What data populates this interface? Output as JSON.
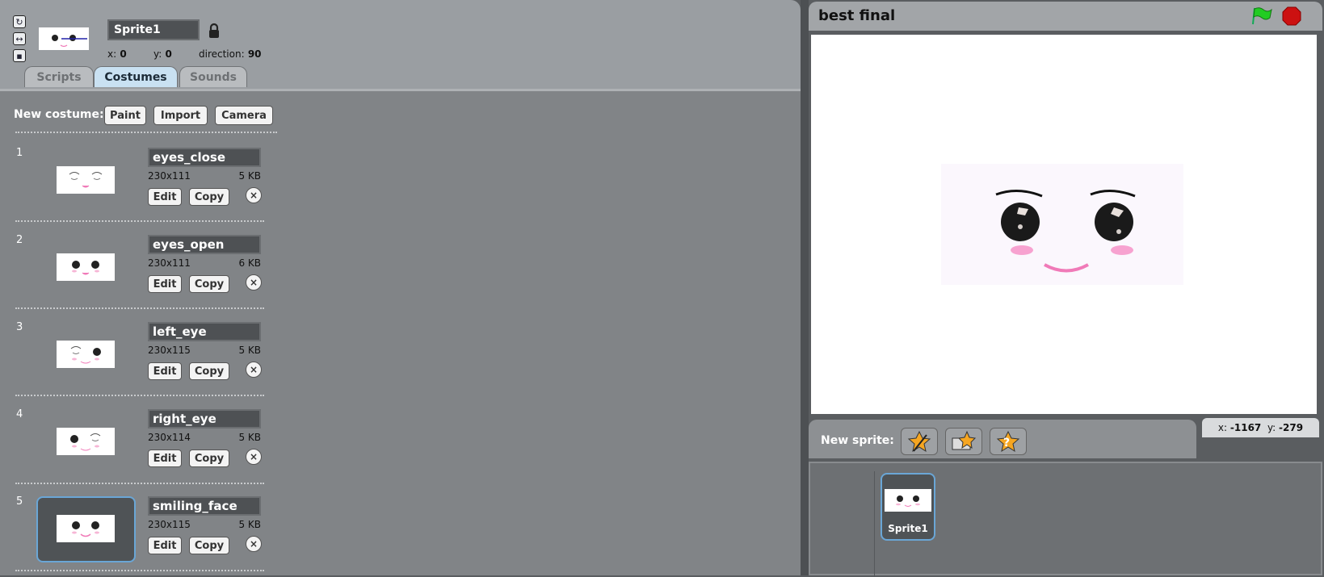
{
  "sprite": {
    "name": "Sprite1",
    "x_label": "x:",
    "x_value": "0",
    "y_label": "y:",
    "y_value": "0",
    "direction_label": "direction:",
    "direction_value": "90"
  },
  "tabs": [
    {
      "label": "Scripts",
      "active": false
    },
    {
      "label": "Costumes",
      "active": true
    },
    {
      "label": "Sounds",
      "active": false
    }
  ],
  "new_costume": {
    "label": "New costume:",
    "paint": "Paint",
    "import": "Import",
    "camera": "Camera"
  },
  "costumes": [
    {
      "num": "1",
      "name": "eyes_close",
      "size": "230x111",
      "kb": "5 KB",
      "edit": "Edit",
      "copy": "Copy",
      "delete": "×"
    },
    {
      "num": "2",
      "name": "eyes_open",
      "size": "230x111",
      "kb": "6 KB",
      "edit": "Edit",
      "copy": "Copy",
      "delete": "×"
    },
    {
      "num": "3",
      "name": "left_eye",
      "size": "230x115",
      "kb": "5 KB",
      "edit": "Edit",
      "copy": "Copy",
      "delete": "×"
    },
    {
      "num": "4",
      "name": "right_eye",
      "size": "230x114",
      "kb": "5 KB",
      "edit": "Edit",
      "copy": "Copy",
      "delete": "×"
    },
    {
      "num": "5",
      "name": "smiling_face",
      "size": "230x115",
      "kb": "5 KB",
      "edit": "Edit",
      "copy": "Copy",
      "delete": "×"
    }
  ],
  "stage": {
    "title": "best final",
    "mouse_x_label": "x:",
    "mouse_x": "-1167",
    "mouse_y_label": "y:",
    "mouse_y": "-279"
  },
  "sprite_area": {
    "new_sprite_label": "New sprite:",
    "sprites": [
      {
        "name": "Sprite1"
      }
    ]
  },
  "colors": {
    "green_flag": "#22cc22",
    "stop": "#cc1111",
    "selection": "#6aa6d6",
    "blush": "#f07ab8"
  },
  "icons": [
    "rotate-icon",
    "flip-icon",
    "no-rotate-icon",
    "lock-icon",
    "green-flag-icon",
    "stop-icon",
    "paint-sprite-icon",
    "open-sprite-icon",
    "surprise-sprite-icon",
    "close-icon"
  ]
}
